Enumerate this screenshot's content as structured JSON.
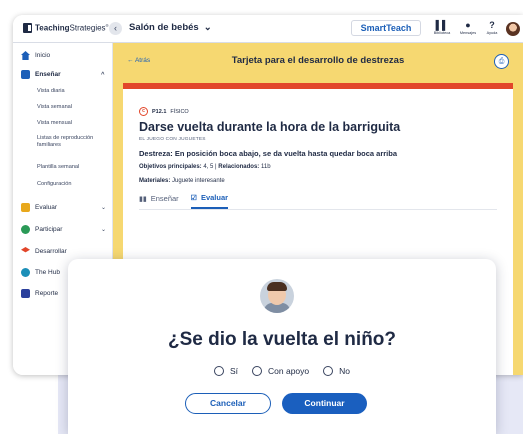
{
  "app": {
    "logo_bold": "Teaching",
    "logo_text": "Strategies",
    "logo_mark": "®",
    "classroom": "Salón de bebés",
    "smartteach": "SmartTeach",
    "topbar_icons": [
      {
        "label": "Biblioteca",
        "icon": "library-icon",
        "glyph": "▌▌"
      },
      {
        "label": "Mensajes",
        "icon": "chat-icon",
        "glyph": "●"
      },
      {
        "label": "Ayuda",
        "icon": "help-icon",
        "glyph": "?"
      }
    ]
  },
  "sidebar": {
    "items": [
      {
        "label": "Inicio",
        "color": "#1c5fb8"
      },
      {
        "label": "Enseñar",
        "color": "#1c5fb8"
      },
      {
        "label": "Evaluar",
        "color": "#e8a81c"
      },
      {
        "label": "Participar",
        "color": "#2b9a57"
      },
      {
        "label": "Desarrollar",
        "color": "#e2462a"
      },
      {
        "label": "The Hub",
        "color": "#1c8fb8"
      },
      {
        "label": "Reporte",
        "color": "#2a3f9c"
      }
    ],
    "subitems": [
      "Vista diaria",
      "Vista semanal",
      "Vista mensual",
      "Listas de reproducción familiares",
      "Plantilla semanal",
      "Configuración"
    ]
  },
  "card": {
    "back": "← Atrás",
    "header_title": "Tarjeta para el desarrollo de destrezas",
    "objective_code": "P12.1",
    "objective_area": "FÍSICO",
    "title": "Darse vuelta durante la hora de la barriguita",
    "subtitle": "EL JUEGO CON JUGUETES",
    "skill": "Destreza: En posición boca abajo, se da vuelta hasta quedar boca arriba",
    "objectives_label": "Objetivos principales:",
    "objectives_value": "4, 5",
    "related_label": "Relacionados:",
    "related_value": "11b",
    "materials_label": "Materiales:",
    "materials_value": "Juguete interesante",
    "tabs": [
      "Enseñar",
      "Evaluar"
    ]
  },
  "modal": {
    "question": "¿Se dio la vuelta el niño?",
    "options": [
      "Sí",
      "Con apoyo",
      "No"
    ],
    "cancel": "Cancelar",
    "continue": "Continuar"
  }
}
